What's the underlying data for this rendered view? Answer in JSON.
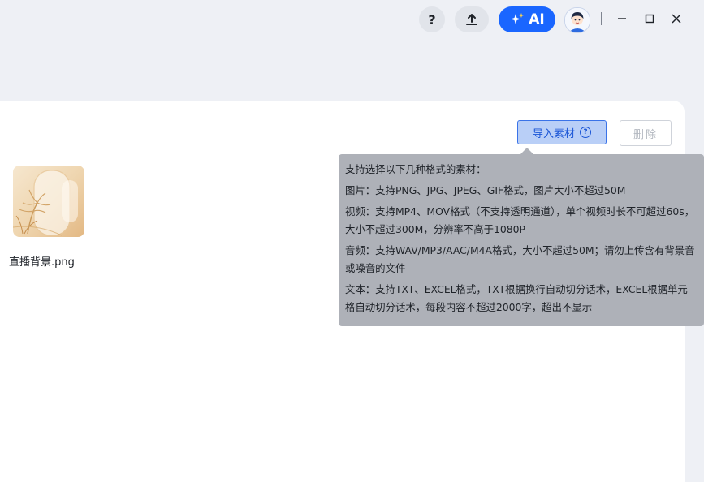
{
  "topbar": {
    "help_label": "?",
    "ai_label": "AI",
    "icons": {
      "upload": "upload-icon",
      "ai": "sparkle-icon",
      "avatar": "avatar-icon",
      "minimize": "minimize-icon",
      "maximize": "maximize-icon",
      "close": "close-icon"
    },
    "ai_color": "#1a66ff"
  },
  "panel": {
    "import_label": "导入素材",
    "delete_label": "删除"
  },
  "assets": [
    {
      "name": "直播背景.png"
    }
  ],
  "tooltip": {
    "title": "支持选择以下几种格式的素材：",
    "image": "图片：支持PNG、JPG、JPEG、GIF格式，图片大小不超过50M",
    "video": "视频：支持MP4、MOV格式（不支持透明通道），单个视频时长不可超过60s，大小不超过300M，分辨率不高于1080P",
    "audio": "音频：支持WAV/MP3/AAC/M4A格式，大小不超过50M；请勿上传含有背景音或噪音的文件",
    "text": "文本：支持TXT、EXCEL格式，TXT根据换行自动切分话术，EXCEL根据单元格自动切分话术，每段内容不超过2000字，超出不显示"
  }
}
